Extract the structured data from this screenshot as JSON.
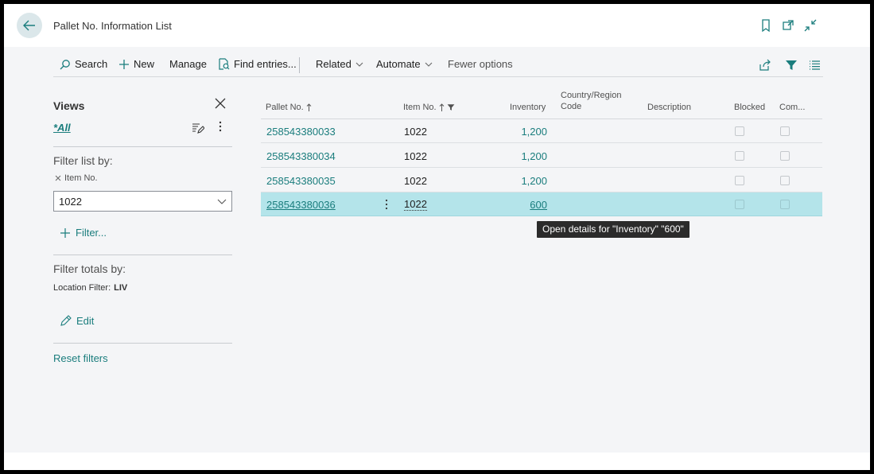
{
  "header": {
    "title": "Pallet No. Information List"
  },
  "actionbar": {
    "search": "Search",
    "new": "New",
    "manage": "Manage",
    "find_entries": "Find entries...",
    "related": "Related",
    "automate": "Automate",
    "fewer_options": "Fewer options"
  },
  "factbox": {
    "views_title": "Views",
    "view_all": "*All",
    "filter_list_by": "Filter list by:",
    "filter_field": "Item No.",
    "filter_value": "1022",
    "add_filter": "Filter...",
    "filter_totals_by": "Filter totals by:",
    "location_filter_label": "Location Filter:",
    "location_filter_value": "LIV",
    "edit": "Edit",
    "reset_filters": "Reset filters"
  },
  "table": {
    "columns": {
      "pallet_no": "Pallet No.",
      "item_no": "Item No.",
      "inventory": "Inventory",
      "country_line1": "Country/Region",
      "country_line2": "Code",
      "description": "Description",
      "blocked": "Blocked",
      "comment": "Com..."
    },
    "rows": [
      {
        "pallet_no": "258543380033",
        "item_no": "1022",
        "inventory": "1,200"
      },
      {
        "pallet_no": "258543380034",
        "item_no": "1022",
        "inventory": "1,200"
      },
      {
        "pallet_no": "258543380035",
        "item_no": "1022",
        "inventory": "1,200"
      },
      {
        "pallet_no": "258543380036",
        "item_no": "1022",
        "inventory": "600"
      }
    ]
  },
  "tooltip": "Open details for \"Inventory\" \"600\"",
  "colors": {
    "accent": "#1a7d7d",
    "selected_row": "#b4e4ea",
    "background": "#f4f5f7"
  }
}
